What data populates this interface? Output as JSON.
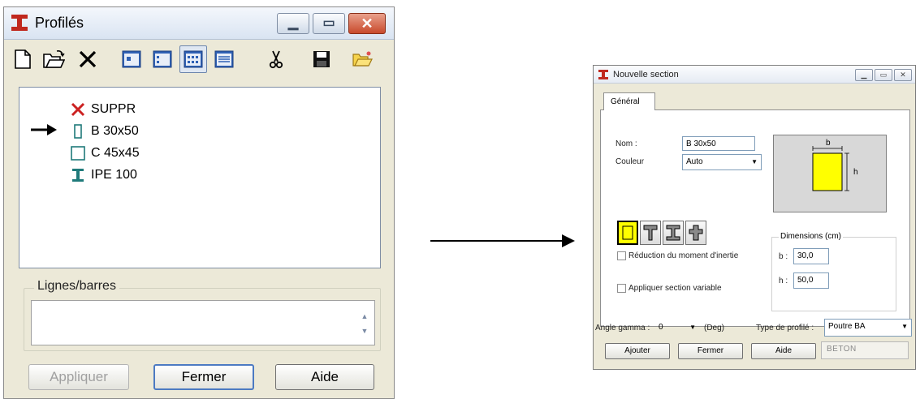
{
  "profiles_window": {
    "title": "Profilés",
    "tree": [
      {
        "label": "SUPPR",
        "icon": "delete-x-icon"
      },
      {
        "label": "B 30x50",
        "icon": "rectangle-section-icon"
      },
      {
        "label": "C 45x45",
        "icon": "square-section-icon"
      },
      {
        "label": "IPE 100",
        "icon": "i-beam-icon"
      }
    ],
    "group_label": "Lignes/barres",
    "buttons": {
      "apply": "Appliquer",
      "close": "Fermer",
      "help": "Aide"
    }
  },
  "section_window": {
    "title": "Nouvelle section",
    "tab": "Général",
    "name_label": "Nom :",
    "name_value": "B 30x50",
    "color_label": "Couleur",
    "color_value": "Auto",
    "preview": {
      "b": "b",
      "h": "h"
    },
    "inertia_reduction": "Réduction du moment d'inertie",
    "variable_section": "Appliquer section variable",
    "dimensions_legend": "Dimensions (cm)",
    "dim_b_label": "b :",
    "dim_b_value": "30,0",
    "dim_h_label": "h :",
    "dim_h_value": "50,0",
    "angle_label": "Angle gamma :",
    "angle_value": "0",
    "angle_unit": "(Deg)",
    "profile_type_label": "Type de profilé :",
    "profile_type_value": "Poutre BA",
    "buttons": {
      "add": "Ajouter",
      "close": "Fermer",
      "help": "Aide"
    },
    "material": "BETON"
  },
  "colors": {
    "section_fill": "#ffff00",
    "delete_red": "#cc2222",
    "profile_teal": "#1f7a7a",
    "title_icon_red": "#c0281e"
  }
}
